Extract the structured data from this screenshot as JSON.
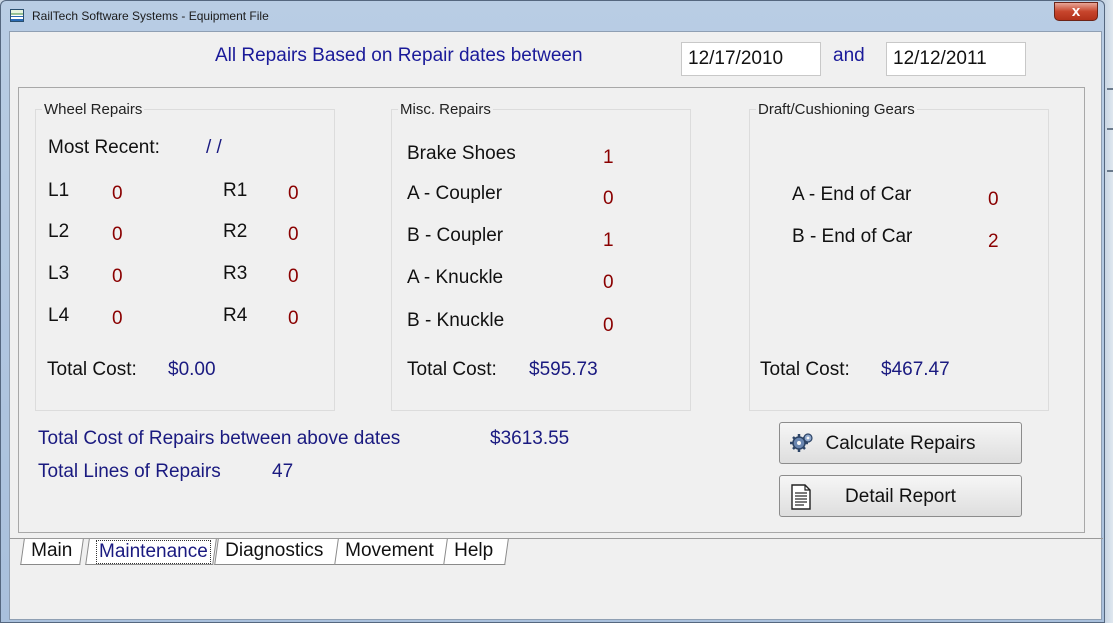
{
  "window": {
    "title": "RailTech Software Systems - Equipment File",
    "close_glyph": "x"
  },
  "header": {
    "label": "All Repairs Based on Repair dates between",
    "start_date": "12/17/2010",
    "and_label": "and",
    "end_date": "12/12/2011"
  },
  "wheel": {
    "title": "Wheel Repairs",
    "most_recent_label": "Most Recent:",
    "most_recent_value": "/ /",
    "left": [
      {
        "label": "L1",
        "value": "0"
      },
      {
        "label": "L2",
        "value": "0"
      },
      {
        "label": "L3",
        "value": "0"
      },
      {
        "label": "L4",
        "value": "0"
      }
    ],
    "right": [
      {
        "label": "R1",
        "value": "0"
      },
      {
        "label": "R2",
        "value": "0"
      },
      {
        "label": "R3",
        "value": "0"
      },
      {
        "label": "R4",
        "value": "0"
      }
    ],
    "total_label": "Total Cost:",
    "total_value": "$0.00"
  },
  "misc": {
    "title": "Misc. Repairs",
    "items": [
      {
        "label": "Brake Shoes",
        "value": "1"
      },
      {
        "label": "A - Coupler",
        "value": "0"
      },
      {
        "label": "B - Coupler",
        "value": "1"
      },
      {
        "label": "A - Knuckle",
        "value": "0"
      },
      {
        "label": "B - Knuckle",
        "value": "0"
      }
    ],
    "total_label": "Total Cost:",
    "total_value": "$595.73"
  },
  "draft": {
    "title": "Draft/Cushioning Gears",
    "items": [
      {
        "label": "A - End of Car",
        "value": "0"
      },
      {
        "label": "B - End of Car",
        "value": "2"
      }
    ],
    "total_label": "Total Cost:",
    "total_value": "$467.47"
  },
  "summary": {
    "total_cost_label": "Total Cost of Repairs between above dates",
    "total_cost_value": "$3613.55",
    "total_lines_label": "Total Lines of Repairs",
    "total_lines_value": "47"
  },
  "buttons": {
    "calculate": "Calculate Repairs",
    "calculate_icon": "gears-icon",
    "detail": "Detail Report",
    "detail_icon": "document-icon"
  },
  "tabs": [
    {
      "label": "Main",
      "active": false
    },
    {
      "label": "Maintenance",
      "active": true
    },
    {
      "label": "Diagnostics",
      "active": false
    },
    {
      "label": "Movement",
      "active": false
    },
    {
      "label": "Help",
      "active": false
    }
  ],
  "colors": {
    "label_blue": "#1a1a99",
    "value_red": "#8a0000",
    "close_red": "#c7452c"
  }
}
